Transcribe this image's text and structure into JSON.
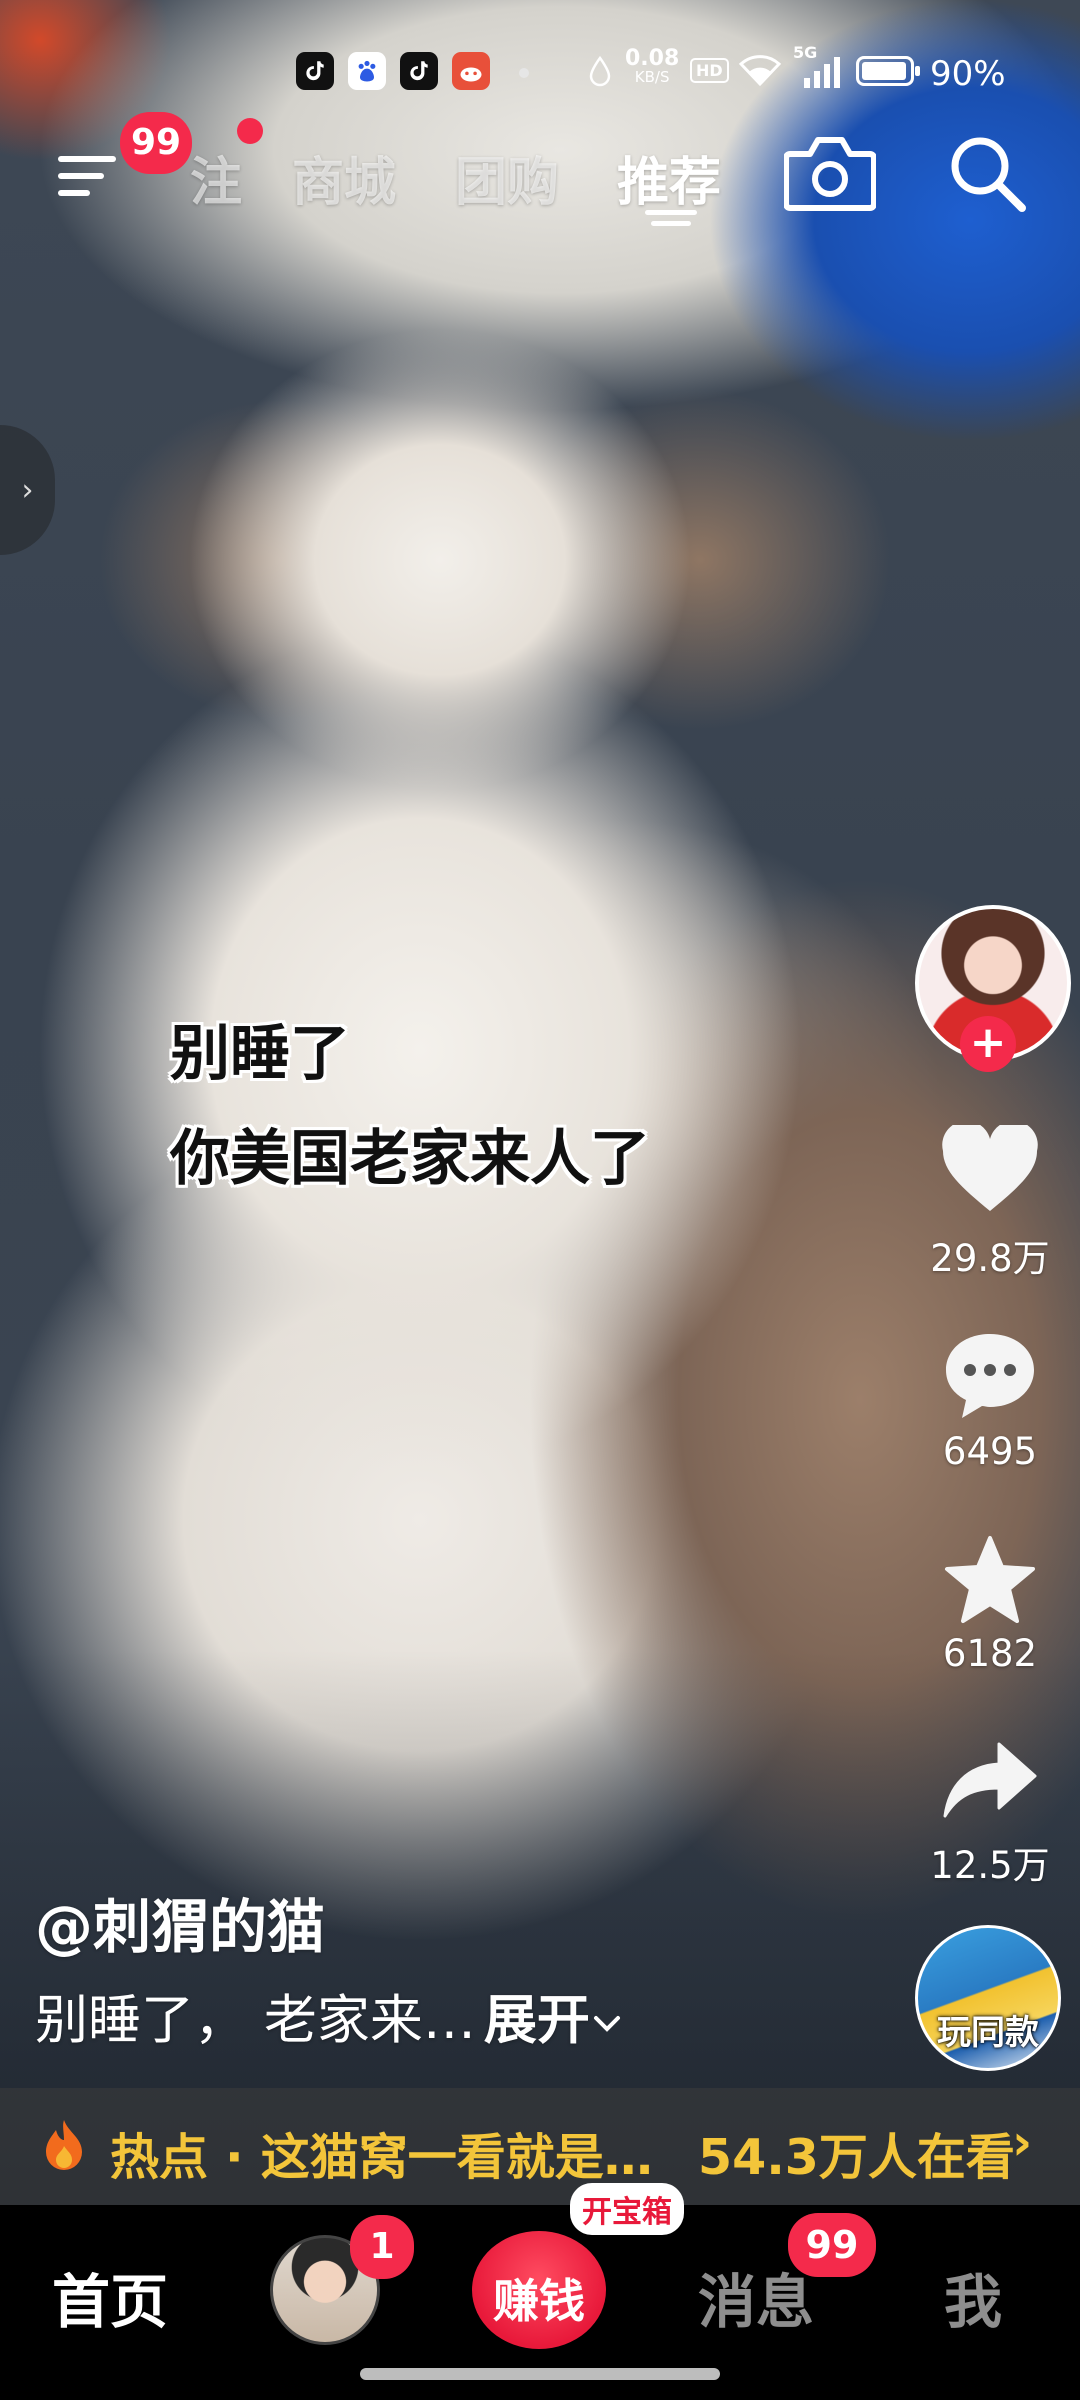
{
  "status_bar": {
    "app_icons": [
      "tiktok-icon",
      "baidu-icon",
      "tiktok-lite-icon",
      "game-icon"
    ],
    "data_speed_value": "0.08",
    "data_speed_unit": "KB/S",
    "hd": "HD",
    "network": "5G",
    "battery": "90%"
  },
  "top_nav": {
    "menu_badge": "99",
    "tabs": [
      "注",
      "商城",
      "团购",
      "推荐"
    ],
    "active_tab": "推荐"
  },
  "video": {
    "overlay_lines": [
      "别睡了",
      "你美国老家来人了"
    ]
  },
  "actions": {
    "likes": "29.8万",
    "comments": "6495",
    "favorites": "6182",
    "shares": "12.5万",
    "use_template": "玩同款"
  },
  "post": {
    "author": "@刺猬的猫",
    "description": "别睡了， 老家来…",
    "expand_label": "展开"
  },
  "hot_bar": {
    "label": "热点 · 这猫窝一看就是…",
    "viewers": "54.3万人在看"
  },
  "bottom_nav": {
    "home": "首页",
    "friends_badge": "1",
    "earn": "赚钱",
    "earn_tag": "开宝箱",
    "messages": "消息",
    "messages_badge": "99",
    "me": "我"
  },
  "colors": {
    "badge_red": "#f42a4b",
    "hot_yellow": "#f3c53a",
    "nav_bg": "#000000"
  }
}
